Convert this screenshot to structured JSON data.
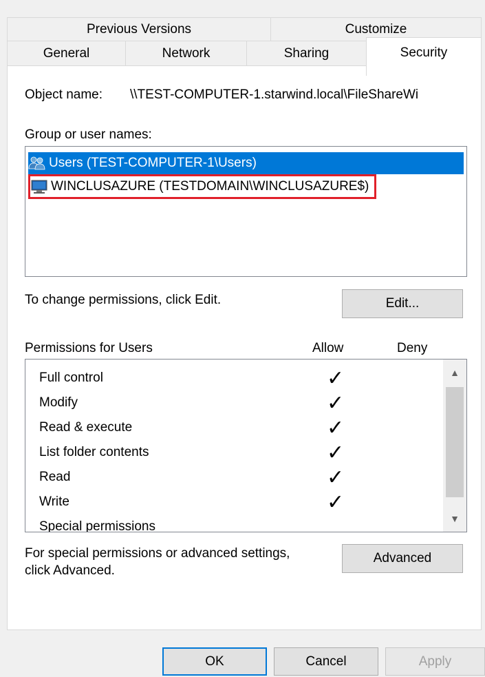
{
  "tabs": {
    "row1": [
      "Previous Versions",
      "Customize"
    ],
    "row2": [
      "General",
      "Network",
      "Sharing",
      "Security"
    ]
  },
  "object_name": {
    "label": "Object name:",
    "value": "\\\\TEST-COMPUTER-1.starwind.local\\FileShareWi"
  },
  "groups": {
    "label": "Group or user names:",
    "items": [
      {
        "name": "Users (TEST-COMPUTER-1\\Users)",
        "icon": "users-group-icon",
        "selected": true
      },
      {
        "name": "WINCLUSAZURE (TESTDOMAIN\\WINCLUSAZURE$)",
        "icon": "computer-icon",
        "highlighted": true
      }
    ]
  },
  "change_hint": "To change permissions, click Edit.",
  "edit_button": "Edit...",
  "permissions": {
    "title": "Permissions for Users",
    "allow_header": "Allow",
    "deny_header": "Deny",
    "rows": [
      {
        "name": "Full control",
        "allow": "✓",
        "deny": ""
      },
      {
        "name": "Modify",
        "allow": "✓",
        "deny": ""
      },
      {
        "name": "Read & execute",
        "allow": "✓",
        "deny": ""
      },
      {
        "name": "List folder contents",
        "allow": "✓",
        "deny": ""
      },
      {
        "name": "Read",
        "allow": "✓",
        "deny": ""
      },
      {
        "name": "Write",
        "allow": "✓",
        "deny": ""
      },
      {
        "name": "Special permissions",
        "allow": "",
        "deny": ""
      }
    ]
  },
  "advanced": {
    "hint_line1": "For special permissions or advanced settings,",
    "hint_line2": "click Advanced.",
    "button": "Advanced"
  },
  "footer": {
    "ok": "OK",
    "cancel": "Cancel",
    "apply": "Apply"
  },
  "colors": {
    "selection": "#0078d7",
    "highlight_border": "#e0202a"
  }
}
